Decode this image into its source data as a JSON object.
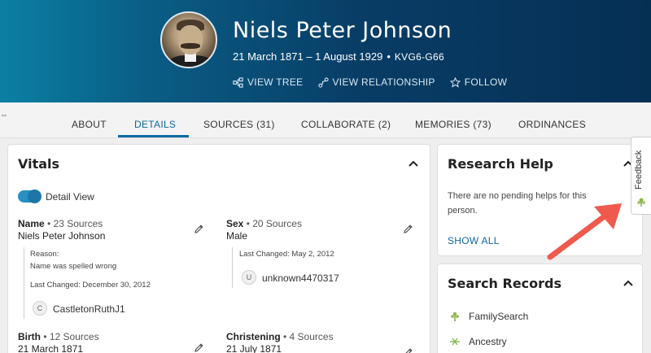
{
  "header": {
    "name": "Niels Peter Johnson",
    "dates": "21 March 1871 – 1 August 1929",
    "separator": "•",
    "person_id": "KVG6-G66",
    "actions": [
      {
        "label": "VIEW TREE",
        "icon": "tree-icon"
      },
      {
        "label": "VIEW RELATIONSHIP",
        "icon": "relationship-icon"
      },
      {
        "label": "FOLLOW",
        "icon": "star-icon"
      }
    ]
  },
  "tabs": [
    {
      "label": "ABOUT",
      "active": false
    },
    {
      "label": "DETAILS",
      "active": true
    },
    {
      "label": "SOURCES (31)",
      "active": false
    },
    {
      "label": "COLLABORATE (2)",
      "active": false
    },
    {
      "label": "MEMORIES (73)",
      "active": false
    },
    {
      "label": "ORDINANCES",
      "active": false
    }
  ],
  "vitals": {
    "title": "Vitals",
    "toggle_label": "Detail View",
    "toggle_on": true,
    "name": {
      "label": "Name",
      "bullet": " • ",
      "sources": "23 Sources",
      "value": "Niels Peter Johnson",
      "reason_label": "Reason:",
      "reason": "Name was spelled wrong",
      "last_changed": "Last Changed: December 30, 2012",
      "contributor_initial": "C",
      "contributor": "CastletonRuthJ1"
    },
    "sex": {
      "label": "Sex",
      "bullet": " • ",
      "sources": "20 Sources",
      "value": "Male",
      "last_changed": "Last Changed: May 2, 2012",
      "contributor_initial": "U",
      "contributor": "unknown4470317"
    },
    "birth": {
      "label": "Birth",
      "bullet": " • ",
      "sources": "12 Sources",
      "value": "21 March 1871"
    },
    "christening": {
      "label": "Christening",
      "bullet": " • ",
      "sources": "4 Sources",
      "value": "21 July 1871"
    }
  },
  "research_help": {
    "title": "Research Help",
    "text": "There are no pending helps for this person.",
    "show_all": "SHOW ALL"
  },
  "search_records": {
    "title": "Search Records",
    "items": [
      {
        "label": "FamilySearch",
        "icon": "familysearch-tree-icon"
      },
      {
        "label": "Ancestry",
        "icon": "ancestry-leaf-icon"
      }
    ]
  },
  "feedback": {
    "label": "Feedback"
  },
  "colors": {
    "accent": "#0a6aa1",
    "annotation_arrow": "#ef5a4c",
    "header_dark": "#062f54",
    "header_light": "#0b7fa3"
  }
}
